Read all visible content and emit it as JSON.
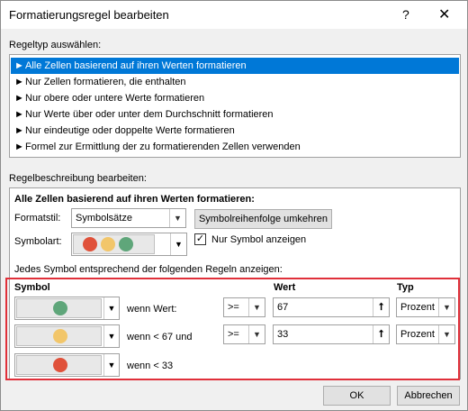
{
  "window": {
    "title": "Formatierungsregel bearbeiten",
    "help": "?",
    "close": "✕"
  },
  "rule_type": {
    "label": "Regeltyp auswählen:",
    "arrow": "►",
    "items": [
      "Alle Zellen basierend auf ihren Werten formatieren",
      "Nur Zellen formatieren, die enthalten",
      "Nur obere oder untere Werte formatieren",
      "Nur Werte über oder unter dem Durchschnitt formatieren",
      "Nur eindeutige oder doppelte Werte formatieren",
      "Formel zur Ermittlung der zu formatierenden Zellen verwenden"
    ],
    "selected_index": 0
  },
  "description": {
    "label": "Regelbeschreibung bearbeiten:",
    "heading": "Alle Zellen basierend auf ihren Werten formatieren:",
    "format_style_label": "Formatstil:",
    "format_style_value": "Symbolsätze",
    "reverse_button": "Symbolreihenfolge umkehren",
    "icon_style_label": "Symbolart:",
    "icon_only_label": "Nur Symbol anzeigen",
    "icon_only_checked": true,
    "rules_intro": "Jedes Symbol entsprechend der folgenden Regeln anzeigen:",
    "col_symbol": "Symbol",
    "col_value": "Wert",
    "col_type": "Typ",
    "rows": [
      {
        "color": "#5fa67a",
        "condition": "wenn Wert:",
        "operator": ">=",
        "value": "67",
        "type": "Prozent"
      },
      {
        "color": "#f2c66a",
        "condition": "wenn < 67 und",
        "operator": ">=",
        "value": "33",
        "type": "Prozent"
      },
      {
        "color": "#e0513a",
        "condition": "wenn < 33"
      }
    ],
    "icon_set_colors": [
      "#e0513a",
      "#f2c66a",
      "#5fa67a"
    ]
  },
  "buttons": {
    "ok": "OK",
    "cancel": "Abbrechen"
  }
}
